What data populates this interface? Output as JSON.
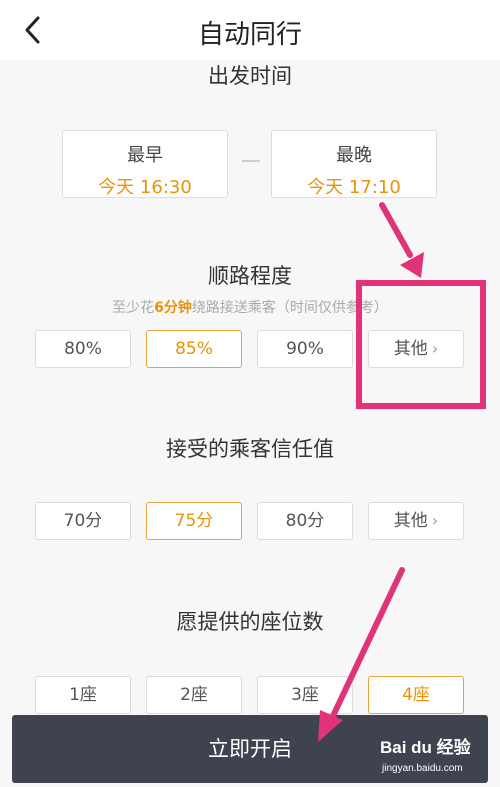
{
  "header": {
    "title": "自动同行",
    "back_icon": "chevron-left-icon"
  },
  "departure": {
    "title": "出发时间",
    "earliest": {
      "label": "最早",
      "value": "今天 16:30"
    },
    "latest": {
      "label": "最晚",
      "value": "今天 17:10"
    }
  },
  "detour": {
    "title": "顺路程度",
    "hint_prefix": "至少花",
    "hint_highlight": "6分钟",
    "hint_suffix": "绕路接送乘客（时间仅供参考）",
    "options": [
      "80%",
      "85%",
      "90%",
      "其他"
    ],
    "selected": "85%"
  },
  "trust": {
    "title": "接受的乘客信任值",
    "options": [
      "70分",
      "75分",
      "80分",
      "其他"
    ],
    "selected": "75分"
  },
  "seats": {
    "title": "愿提供的座位数",
    "options": [
      "1座",
      "2座",
      "3座",
      "4座"
    ],
    "selected": "4座"
  },
  "action": {
    "start_label": "立即开启"
  },
  "watermark": {
    "logo_text": "Bai du 经验",
    "url": "jingyan.baidu.com"
  },
  "colors": {
    "accent": "#e8930a",
    "annotation": "#e0337a",
    "button_bg": "#3f434f"
  }
}
